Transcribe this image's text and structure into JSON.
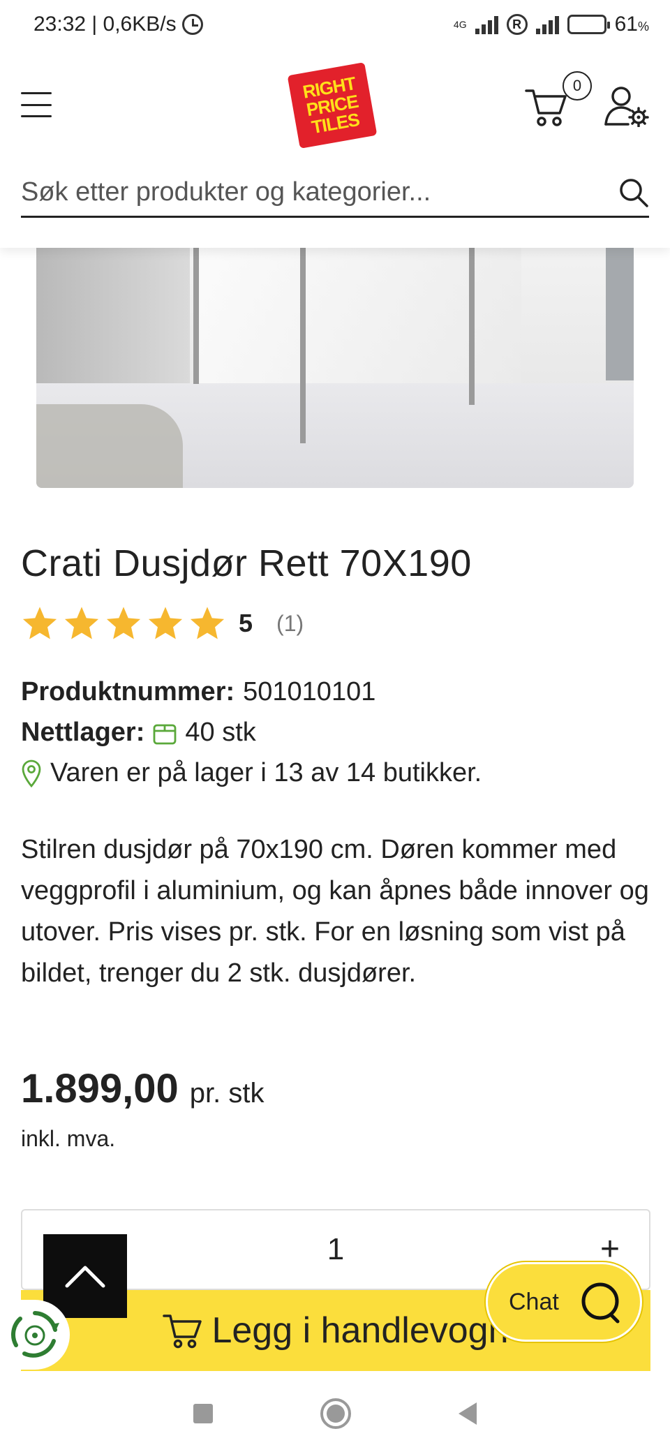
{
  "status_bar": {
    "time_speed": "23:32 | 0,6KB/s",
    "network_type": "4G",
    "battery_percent": "61",
    "battery_unit": "%"
  },
  "header": {
    "logo_lines": [
      "RIGHT",
      "PRICE",
      "TILES"
    ],
    "cart_count": "0",
    "search_placeholder": "Søk etter produkter og kategorier..."
  },
  "product": {
    "title": "Crati Dusjdør Rett 70X190",
    "rating_value": "5",
    "rating_count": "(1)",
    "star_count": 5,
    "product_number_label": "Produktnummer:",
    "product_number": "501010101",
    "stock_label": "Nettlager:",
    "stock_value": "40 stk",
    "store_availability": "Varen er på lager i 13 av 14 butikker.",
    "description": "Stilren dusjdør på 70x190 cm. Døren kommer med veggprofil i aluminium, og kan åpnes både innover og utover. Pris vises pr. stk. For en løsning som vist på bildet, trenger du 2 stk. dusjdører.",
    "price": "1.899,00",
    "price_unit": "pr. stk",
    "vat_note": "inkl. mva."
  },
  "purchase": {
    "quantity": "1",
    "plus_label": "+",
    "add_to_cart_label": "Legg i handlevogn"
  },
  "chat": {
    "label": "Chat"
  },
  "colors": {
    "accent_yellow": "#fbde3c",
    "star_orange": "#f6b72f",
    "logo_red": "#e2212b",
    "logo_yellow": "#ffe11a",
    "stock_green": "#5aa83a"
  }
}
